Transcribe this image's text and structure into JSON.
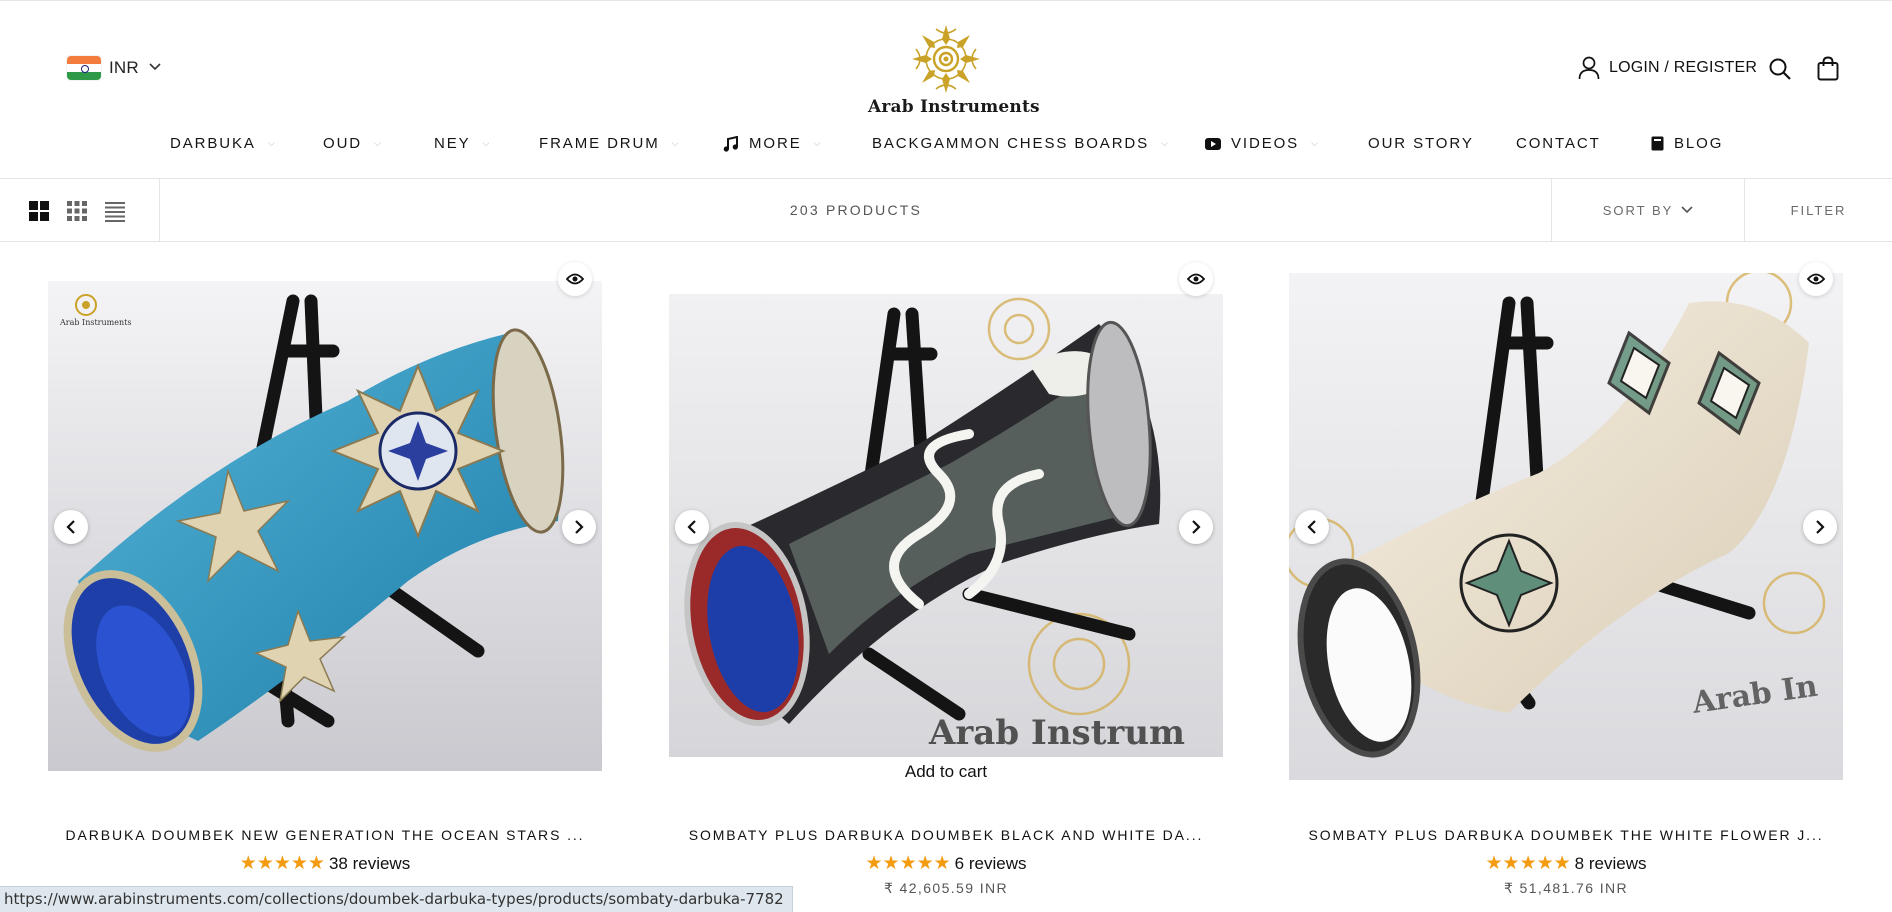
{
  "header": {
    "currency": {
      "code": "INR",
      "flag_icon": "india-flag-icon"
    },
    "logo_text": "Arab Instruments",
    "login_label": "LOGIN / REGISTER",
    "icons": [
      "user-icon",
      "search-icon",
      "bag-icon"
    ]
  },
  "nav": {
    "items": [
      {
        "label": "DARBUKA",
        "dropdown": true
      },
      {
        "label": "OUD",
        "dropdown": true
      },
      {
        "label": "NEY",
        "dropdown": true
      },
      {
        "label": "FRAME DRUM",
        "dropdown": true
      },
      {
        "label": "MORE",
        "dropdown": true,
        "icon": "music-note-icon"
      },
      {
        "label": "BACKGAMMON CHESS BOARDS",
        "dropdown": true
      },
      {
        "label": "VIDEOS",
        "dropdown": true,
        "icon": "youtube-icon"
      },
      {
        "label": "OUR STORY",
        "dropdown": false
      },
      {
        "label": "CONTACT",
        "dropdown": false
      },
      {
        "label": "BLOG",
        "dropdown": false,
        "icon": "book-icon"
      }
    ]
  },
  "toolbar": {
    "product_count": "203 PRODUCTS",
    "sort_label": "SORT BY",
    "filter_label": "FILTER",
    "view_modes": [
      "grid-large-icon",
      "grid-small-icon",
      "list-icon"
    ]
  },
  "products": [
    {
      "title": "DARBUKA DOUMBEK NEW GENERATION THE OCEAN STARS ...",
      "stars": "★★★★★",
      "reviews": "38 reviews",
      "price": "",
      "add_to_cart": "",
      "image_logo_text": "Arab Instruments"
    },
    {
      "title": "SOMBATY PLUS DARBUKA DOUMBEK BLACK AND WHITE DA...",
      "stars": "★★★★★",
      "reviews": "6 reviews",
      "price": "₹ 42,605.59 INR",
      "add_to_cart": "Add to cart",
      "image_watermark": "Arab Instrum"
    },
    {
      "title": "SOMBATY PLUS DARBUKA DOUMBEK THE WHITE FLOWER J...",
      "stars": "★★★★★",
      "reviews": "8 reviews",
      "price": "₹ 51,481.76 INR",
      "add_to_cart": "",
      "image_watermark": "Arab In"
    }
  ],
  "status_bar": {
    "url": "https://www.arabinstruments.com/collections/doumbek-darbuka-types/products/sombaty-darbuka-7782"
  },
  "colors": {
    "star": "#f39c12",
    "text": "#111111",
    "muted": "#555555",
    "border": "#e4e4e4"
  }
}
